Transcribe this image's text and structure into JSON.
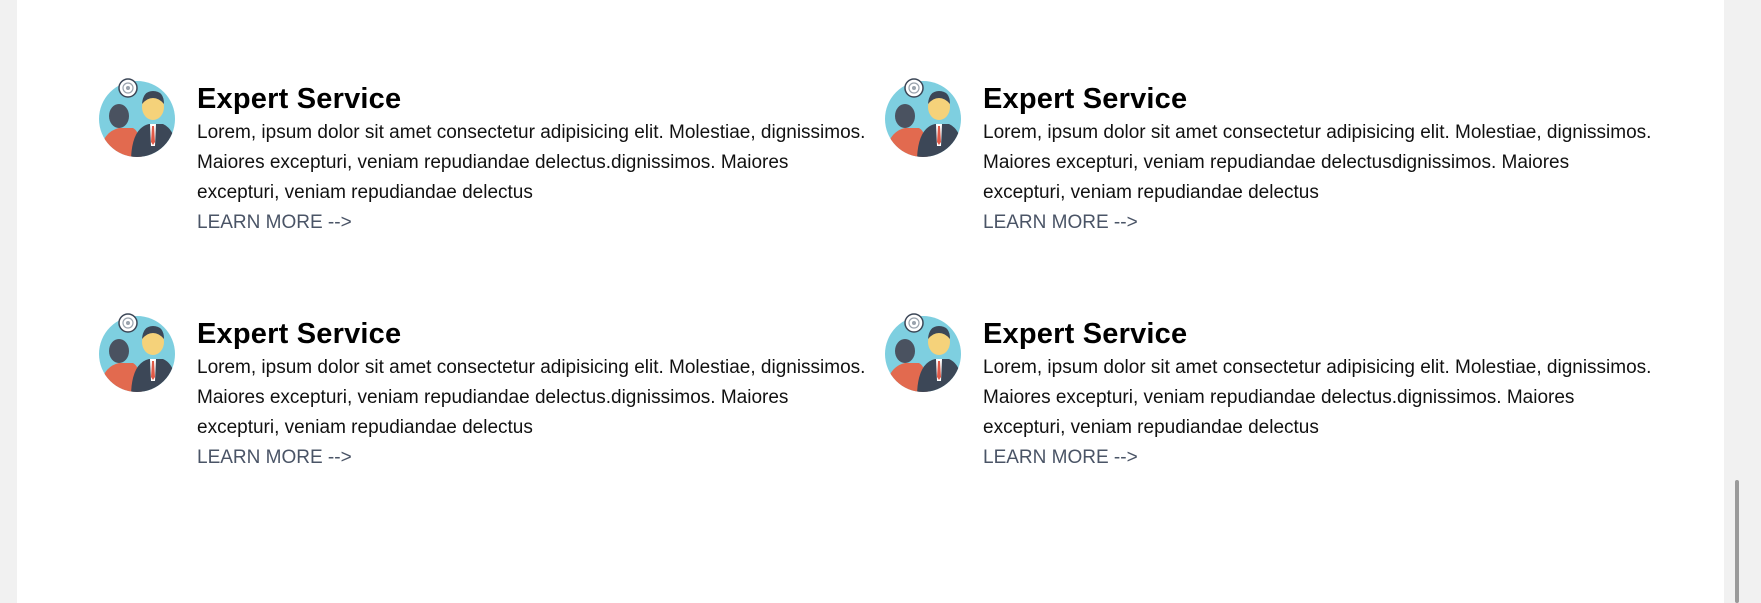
{
  "services": [
    {
      "title": "Expert Service",
      "text": "Lorem, ipsum dolor sit amet consectetur adipisicing elit. Molestiae, dignissimos. Maiores excepturi, veniam repudiandae delectus.dignissimos. Maiores excepturi, veniam repudiandae delectus",
      "link": "LEARN MORE -->",
      "icon": "consultant-icon"
    },
    {
      "title": "Expert Service",
      "text": "Lorem, ipsum dolor sit amet consectetur adipisicing elit. Molestiae, dignissimos. Maiores excepturi, veniam repudiandae delectusdignissimos. Maiores excepturi, veniam repudiandae delectus",
      "link": "LEARN MORE -->",
      "icon": "consultant-icon"
    },
    {
      "title": "Expert Service",
      "text": "Lorem, ipsum dolor sit amet consectetur adipisicing elit. Molestiae, dignissimos. Maiores excepturi, veniam repudiandae delectus.dignissimos. Maiores excepturi, veniam repudiandae delectus",
      "link": "LEARN MORE -->",
      "icon": "consultant-icon"
    },
    {
      "title": "Expert Service",
      "text": "Lorem, ipsum dolor sit amet consectetur adipisicing elit. Molestiae, dignissimos. Maiores excepturi, veniam repudiandae delectus.dignissimos. Maiores excepturi, veniam repudiandae delectus",
      "link": "LEARN MORE -->",
      "icon": "consultant-icon"
    }
  ],
  "colors": {
    "icon_circle": "#7ecfe0",
    "icon_person_front_suit": "#3c4757",
    "icon_person_front_face": "#f5d27a",
    "icon_person_back": "#4a5260",
    "icon_shirt_back": "#e26a4f",
    "icon_tie": "#e05a48",
    "link_color": "#4a5466"
  }
}
